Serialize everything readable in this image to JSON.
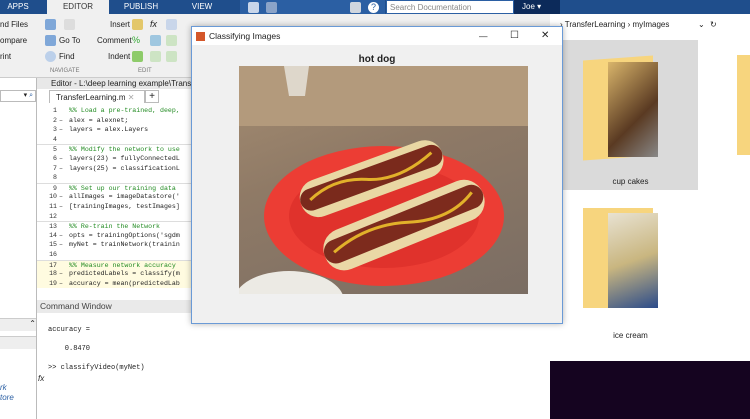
{
  "toolstrip": {
    "tabs": [
      "APPS",
      "EDITOR",
      "PUBLISH",
      "VIEW"
    ],
    "active_tab": "EDITOR"
  },
  "ribbon": {
    "file_group": [
      "nd Files",
      "ompare",
      "rint"
    ],
    "navigate": {
      "go_to": "Go To",
      "find": "Find",
      "label": "NAVIGATE"
    },
    "edit": {
      "insert": "Insert",
      "comment": "Comment",
      "indent": "Indent",
      "label": "EDIT"
    }
  },
  "search": {
    "placeholder": "Search Documentation"
  },
  "user": {
    "name": "Joe"
  },
  "editor": {
    "title": "Editor - L:\\deep learning example\\TransferLearning.m",
    "tab": "TransferLearning.m",
    "add_tab": "+",
    "lines": [
      {
        "n": "1",
        "d": "",
        "t": "%% Load a pre-trained, deep,",
        "c": "cm"
      },
      {
        "n": "2",
        "d": "–",
        "t": "alex = alexnet;",
        "c": ""
      },
      {
        "n": "3",
        "d": "–",
        "t": "layers = alex.Layers",
        "c": ""
      },
      {
        "n": "4",
        "d": "",
        "t": "",
        "c": ""
      },
      {
        "n": "5",
        "d": "",
        "t": "%% Modify the network to use",
        "c": "cm sec"
      },
      {
        "n": "6",
        "d": "–",
        "t": "layers(23) = fullyConnectedL",
        "c": ""
      },
      {
        "n": "7",
        "d": "–",
        "t": "layers(25) = classificationL",
        "c": ""
      },
      {
        "n": "8",
        "d": "",
        "t": "",
        "c": ""
      },
      {
        "n": "9",
        "d": "",
        "t": "%% Set up our training data",
        "c": "cm sec"
      },
      {
        "n": "10",
        "d": "–",
        "t": "allImages = imageDatastore('",
        "c": ""
      },
      {
        "n": "11",
        "d": "–",
        "t": "[trainingImages, testImages]",
        "c": ""
      },
      {
        "n": "12",
        "d": "",
        "t": "",
        "c": ""
      },
      {
        "n": "13",
        "d": "",
        "t": "%% Re-train the Network",
        "c": "cm sec"
      },
      {
        "n": "14",
        "d": "–",
        "t": "opts = trainingOptions('sgdm",
        "c": ""
      },
      {
        "n": "15",
        "d": "–",
        "t": "myNet = trainNetwork(trainin",
        "c": ""
      },
      {
        "n": "16",
        "d": "",
        "t": "",
        "c": ""
      },
      {
        "n": "17",
        "d": "",
        "t": "%% Measure network accuracy",
        "c": "cm sec hl"
      },
      {
        "n": "18",
        "d": "–",
        "t": "predictedLabels = classify(m",
        "c": "hl"
      },
      {
        "n": "19",
        "d": "–",
        "t": "accuracy = mean(predictedLab",
        "c": "hl"
      }
    ]
  },
  "command_window": {
    "title": "Command Window",
    "lines": [
      "accuracy =",
      "    0.8470",
      ">> classifyVideo(myNet)"
    ],
    "fx": "fx"
  },
  "left_pane": {
    "links": [
      "rk",
      "tore"
    ]
  },
  "explorer": {
    "crumbs": [
      "TransferLearning",
      "myImages"
    ],
    "folders": [
      "cup cakes",
      "ice cream"
    ]
  },
  "figure": {
    "window_title": "Classifying Images",
    "label": "hot dog"
  }
}
